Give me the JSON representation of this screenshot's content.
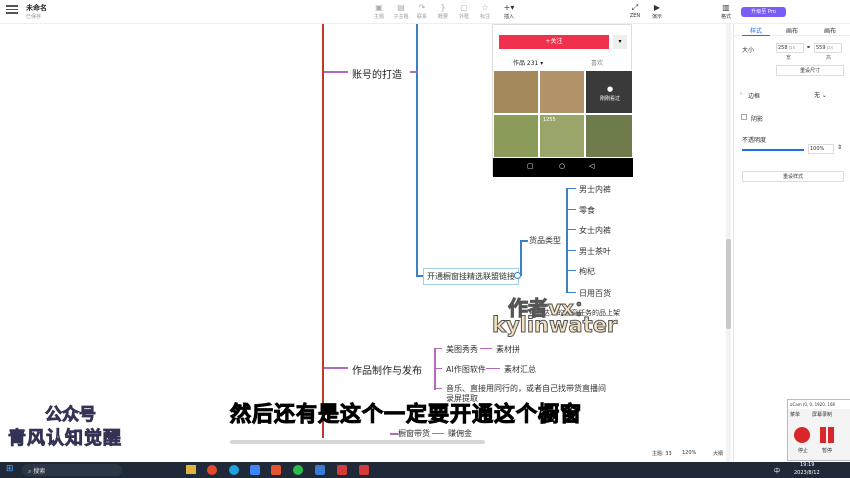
{
  "doc": {
    "title": "未命名",
    "status": "已保存"
  },
  "toolbar": {
    "items": [
      "主题",
      "子主题",
      "联系",
      "概要",
      "外框",
      "标注"
    ],
    "insert_label": "插入",
    "zoom_label": "ZEN",
    "present_label": "演示",
    "format_label": "格式",
    "upgrade_label": "升级至 Pro"
  },
  "panel": {
    "tabs": [
      "样式",
      "画布",
      "画布"
    ],
    "size_label": "大小",
    "width_value": "258",
    "width_unit": "px",
    "height_value": "559",
    "height_unit": "px",
    "width_caption": "宽",
    "height_caption": "高",
    "reset_size": "重设尺寸",
    "border_label": "边框",
    "border_value": "无",
    "shadow_label": "阴影",
    "opacity_label": "不透明度",
    "opacity_value": "100%",
    "reset_style": "重设样式"
  },
  "mindmap": {
    "account_node": "账号的打造",
    "follow_button": "+关注",
    "works_tab": "作品 231 ▾",
    "likes_tab": "喜欢",
    "just_watched": "刚刚看过",
    "view_count": "1255",
    "goods_type": "货品类型",
    "goods": [
      "男士内裤",
      "零食",
      "女士内裤",
      "男士茶叶",
      "枸杞",
      "日用百货"
    ],
    "showcase_node": "开通橱窗挂精选联盟链接",
    "upload_node": "电商达人的橱窗任务的品上架",
    "works_node": "作品制作与发布",
    "works_children": [
      "美图秀秀",
      "AI作图软件",
      "音乐、直接用同行的，或者自己找带货直播间录屏提取"
    ],
    "works_leaf": [
      "素材拼",
      "素材汇总"
    ],
    "showcase_sale": "橱窗带货",
    "commission": "赚佣金"
  },
  "overlay": {
    "author_label": "作者vx：",
    "author_id": "kylinwater",
    "subtitle": "然后还有是这个一定要开通这个橱窗",
    "wm_line1": "公众号",
    "wm_line2": "青风认知觉醒"
  },
  "statusbar": {
    "topic_count": "主题: 33",
    "zoom": "120%",
    "size_label": "大纲"
  },
  "ocam": {
    "title": "oCam (0, 0, 1920, 108",
    "menu": "菜单",
    "record": "屏幕录制",
    "stop": "停止",
    "pause": "暂停"
  },
  "taskbar": {
    "search": "搜索",
    "time": "19:19",
    "date": "2023/8/12",
    "ime": "中"
  }
}
